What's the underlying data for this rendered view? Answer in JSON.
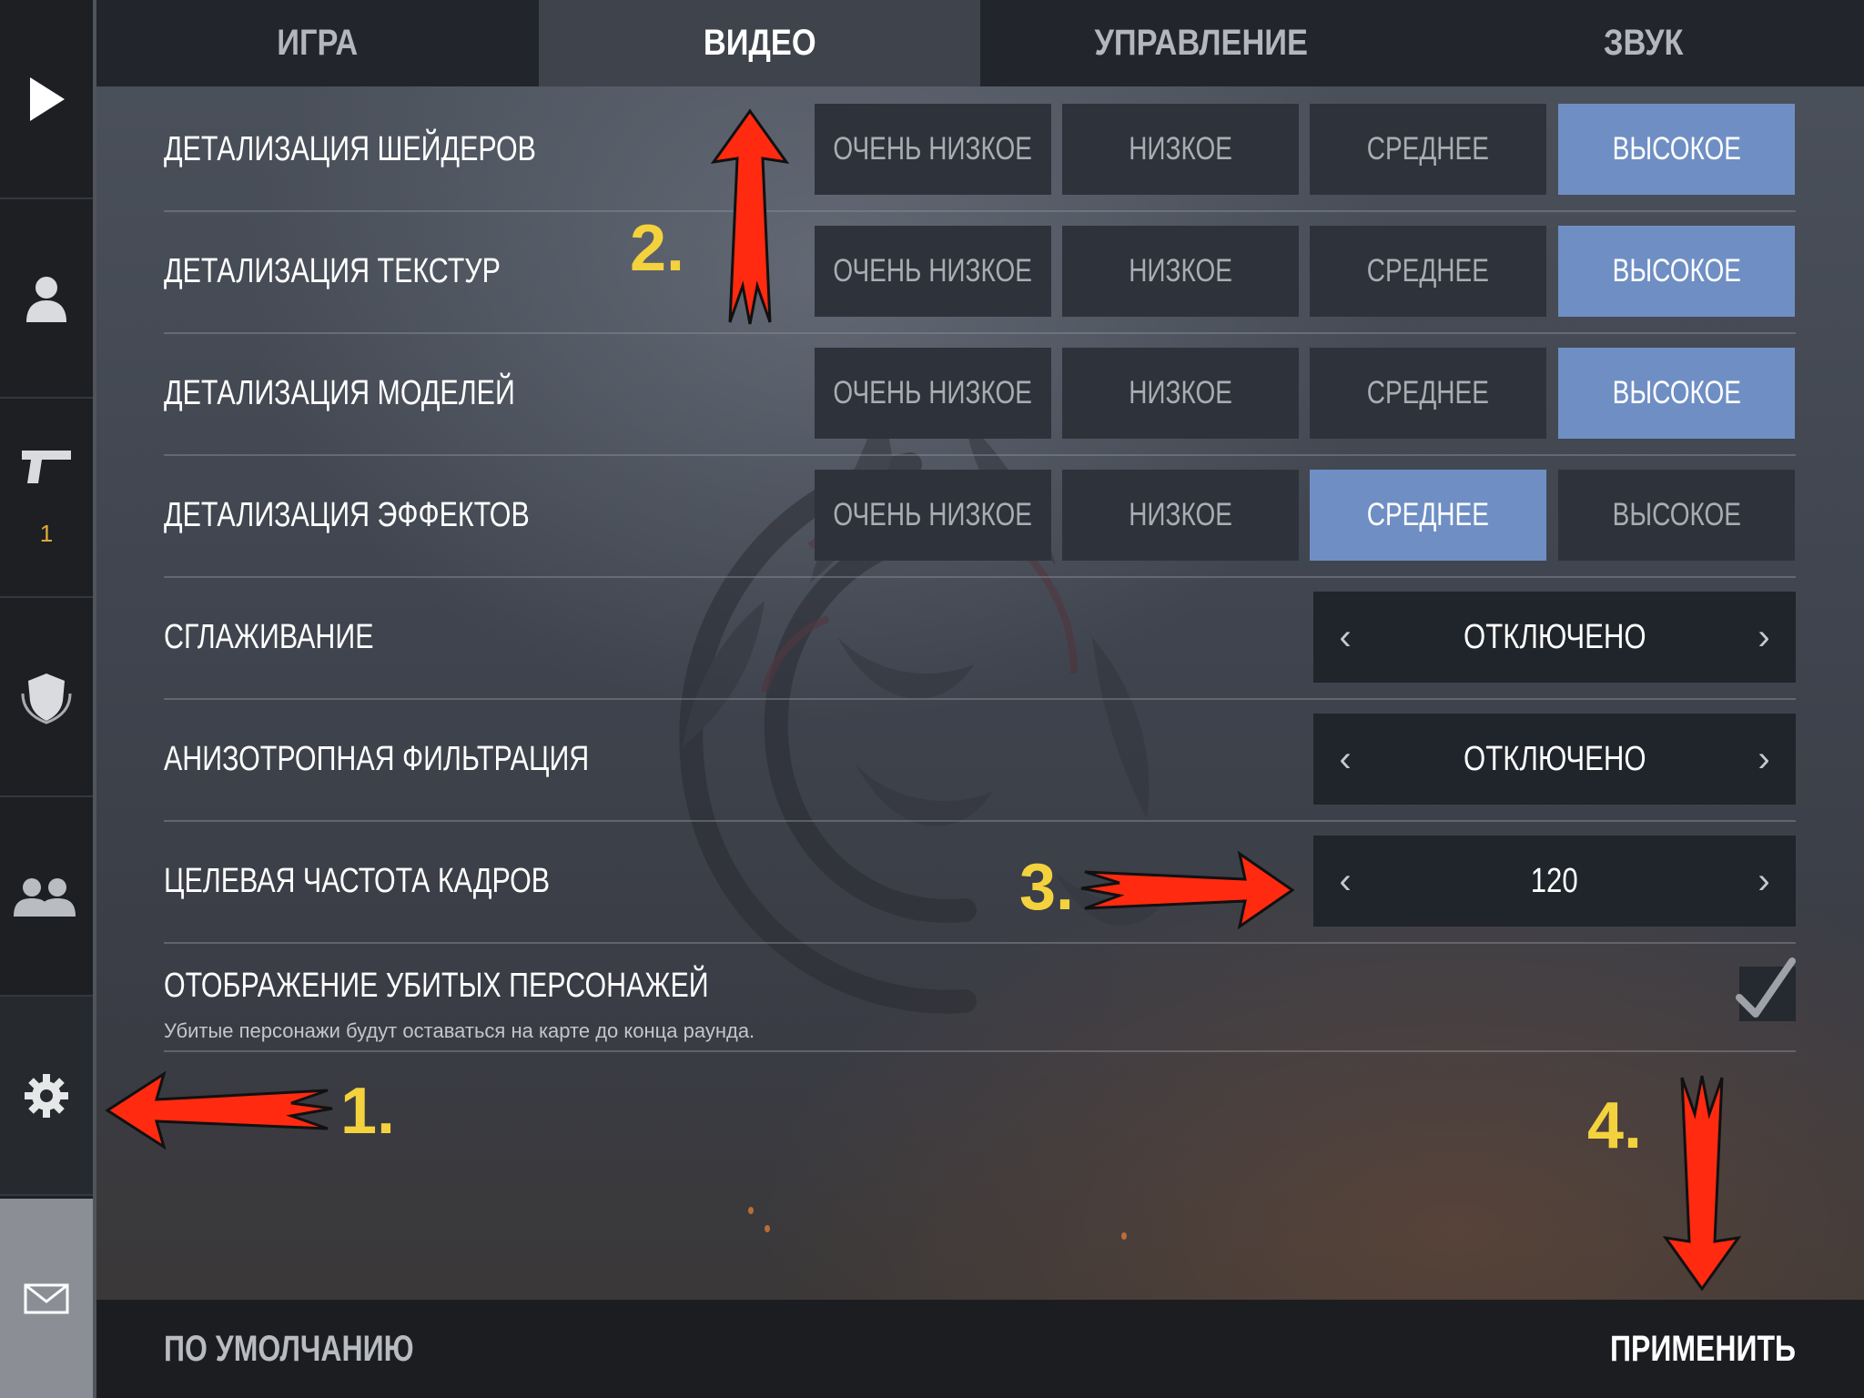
{
  "sidebar": {
    "items": [
      {
        "name": "play-icon"
      },
      {
        "name": "profile-icon"
      },
      {
        "name": "pistol-icon",
        "count": "1"
      },
      {
        "name": "shield-icon"
      },
      {
        "name": "friends-icon"
      },
      {
        "name": "gear-icon"
      },
      {
        "name": "mail-icon"
      }
    ]
  },
  "tabs": [
    {
      "label": "ИГРА",
      "active": false
    },
    {
      "label": "ВИДЕО",
      "active": true
    },
    {
      "label": "УПРАВЛЕНИЕ",
      "active": false
    },
    {
      "label": "ЗВУК",
      "active": false
    }
  ],
  "quality_options": [
    "ОЧЕНЬ НИЗКОЕ",
    "НИЗКОЕ",
    "СРЕДНЕЕ",
    "ВЫСОКОЕ"
  ],
  "settings": {
    "shaders": {
      "label": "ДЕТАЛИЗАЦИЯ ШЕЙДЕРОВ",
      "selected": "ВЫСОКОЕ"
    },
    "textures": {
      "label": "ДЕТАЛИЗАЦИЯ ТЕКСТУР",
      "selected": "ВЫСОКОЕ"
    },
    "models": {
      "label": "ДЕТАЛИЗАЦИЯ МОДЕЛЕЙ",
      "selected": "ВЫСОКОЕ"
    },
    "effects": {
      "label": "ДЕТАЛИЗАЦИЯ ЭФФЕКТОВ",
      "selected": "СРЕДНЕЕ"
    },
    "antialiasing": {
      "label": "СГЛАЖИВАНИЕ",
      "value": "ОТКЛЮЧЕНО"
    },
    "anisotropic": {
      "label": "АНИЗОТРОПНАЯ ФИЛЬТРАЦИЯ",
      "value": "ОТКЛЮЧЕНО"
    },
    "framerate": {
      "label": "ЦЕЛЕВАЯ ЧАСТОТА КАДРОВ",
      "value": "120"
    },
    "ragdolls": {
      "label": "ОТОБРАЖЕНИЕ УБИТЫХ ПЕРСОНАЖЕЙ",
      "description": "Убитые персонажи будут оставаться на карте до конца раунда.",
      "checked": true
    }
  },
  "stepper_arrows": {
    "prev": "‹",
    "next": "›"
  },
  "bottom": {
    "default_label": "ПО УМОЛЧАНИЮ",
    "apply_label": "ПРИМЕНИТЬ"
  },
  "annotations": {
    "n1": "1.",
    "n2": "2.",
    "n3": "3.",
    "n4": "4."
  },
  "colors": {
    "selected": "#6f8fc4",
    "annotation_arrow": "#ff2a10",
    "annotation_number": "#f4d23d",
    "badge": "#e0a93b"
  }
}
